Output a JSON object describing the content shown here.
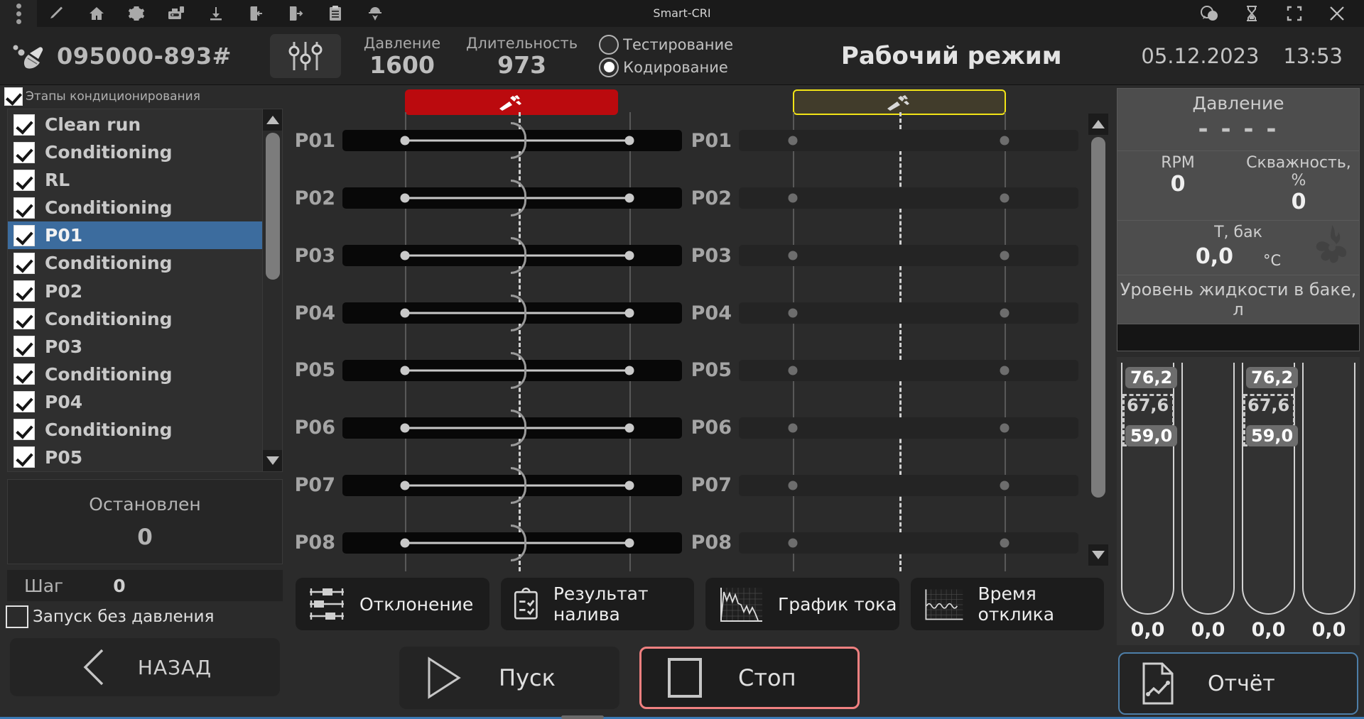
{
  "titlebar": {
    "title": "Smart-CRI",
    "left_icons": [
      "menu-dots-icon",
      "pencil-icon",
      "home-icon",
      "gear-icon",
      "toolbox-icon",
      "download-icon",
      "import-icon",
      "export-icon",
      "clipboard-icon",
      "worker-icon"
    ],
    "right_icons": [
      "chat-icon",
      "hourglass-icon",
      "fullscreen-icon",
      "close-icon"
    ]
  },
  "header": {
    "serial": "095000-893#",
    "pressure_label": "Давление",
    "pressure_value": "1600",
    "duration_label": "Длительность",
    "duration_value": "973",
    "radio_testing": "Тестирование",
    "radio_coding": "Кодирование",
    "selected_radio": "coding",
    "mode": "Рабочий режим",
    "date": "05.12.2023",
    "time": "13:53"
  },
  "sidebar": {
    "header_label": "Этапы кондиционирования",
    "items": [
      {
        "label": "Clean run",
        "checked": true,
        "selected": false
      },
      {
        "label": "Conditioning",
        "checked": true,
        "selected": false
      },
      {
        "label": "RL",
        "checked": true,
        "selected": false
      },
      {
        "label": "Conditioning",
        "checked": true,
        "selected": false
      },
      {
        "label": "P01",
        "checked": true,
        "selected": true
      },
      {
        "label": "Conditioning",
        "checked": true,
        "selected": false
      },
      {
        "label": "P02",
        "checked": true,
        "selected": false
      },
      {
        "label": "Conditioning",
        "checked": true,
        "selected": false
      },
      {
        "label": "P03",
        "checked": true,
        "selected": false
      },
      {
        "label": "Conditioning",
        "checked": true,
        "selected": false
      },
      {
        "label": "P04",
        "checked": true,
        "selected": false
      },
      {
        "label": "Conditioning",
        "checked": true,
        "selected": false
      },
      {
        "label": "P05",
        "checked": true,
        "selected": false
      }
    ],
    "status_label": "Остановлен",
    "status_value": "0",
    "step_label": "Шаг",
    "step_value": "0",
    "no_pressure_label": "Запуск без давления",
    "no_pressure_checked": false,
    "back_label": "НАЗАД"
  },
  "channels": {
    "left_labels": [
      "P01",
      "P02",
      "P03",
      "P04",
      "P05",
      "P06",
      "P07",
      "P08"
    ],
    "right_labels": [
      "P01",
      "P02",
      "P03",
      "P04",
      "P05",
      "P06",
      "P07",
      "P08"
    ],
    "left_plug_icon": "plug-icon",
    "right_plug_icon": "plug-icon"
  },
  "tools": [
    {
      "label": "Отклонение",
      "icon": "sliders-icon"
    },
    {
      "label": "Результат налива",
      "icon": "clipboard-check-icon"
    },
    {
      "label": "График тока",
      "icon": "current-graph-icon"
    },
    {
      "label": "Время отклика",
      "icon": "response-graph-icon"
    }
  ],
  "actions": {
    "start_label": "Пуск",
    "stop_label": "Стоп"
  },
  "right_panel": {
    "pressure_title": "Давление",
    "pressure_value": "- - - -",
    "rpm_label": "RPM",
    "rpm_value": "0",
    "duty_label": "Скважность, %",
    "duty_value": "0",
    "tank_temp_label": "Т, бак",
    "tank_temp_value": "0,0",
    "tank_temp_unit": "°C",
    "level_label": "Уровень жидкости в баке, л",
    "tubes": [
      {
        "top": "76,2",
        "mid": "67,6",
        "bot": "59,0",
        "value": "0,0",
        "has_marks": true
      },
      {
        "top": "",
        "mid": "",
        "bot": "",
        "value": "0,0",
        "has_marks": false
      },
      {
        "top": "76,2",
        "mid": "67,6",
        "bot": "59,0",
        "value": "0,0",
        "has_marks": true
      },
      {
        "top": "",
        "mid": "",
        "bot": "",
        "value": "0,0",
        "has_marks": false
      }
    ],
    "report_label": "Отчёт"
  },
  "colors": {
    "accent_blue": "#3c6c9e",
    "danger_red": "#bb0a0e",
    "warn_yellow": "#f2e416",
    "stop_border": "#f08080",
    "report_border": "#4d7ea8"
  }
}
